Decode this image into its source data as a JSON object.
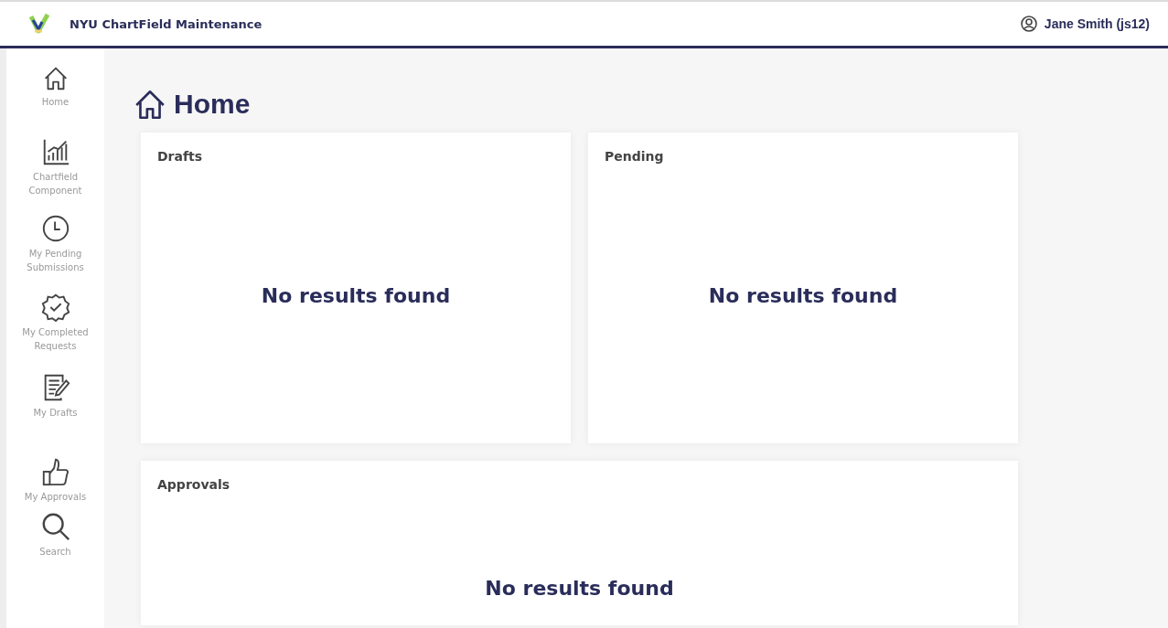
{
  "header": {
    "app_title": "NYU ChartField Maintenance",
    "user": "Jane Smith (js12)"
  },
  "sidebar": {
    "items": [
      {
        "label": "Home"
      },
      {
        "label": "Chartfield Component"
      },
      {
        "label": "My Pending Submissions"
      },
      {
        "label": "My Completed Requests"
      },
      {
        "label": "My Drafts"
      },
      {
        "label": "My Approvals"
      },
      {
        "label": "Search"
      }
    ]
  },
  "page_title": "Home",
  "cards": [
    {
      "title": "Drafts",
      "message": "No results found",
      "kind": "half"
    },
    {
      "title": "Pending",
      "message": "No results found",
      "kind": "half"
    },
    {
      "title": "Approvals",
      "message": "No results found",
      "kind": "full"
    }
  ]
}
